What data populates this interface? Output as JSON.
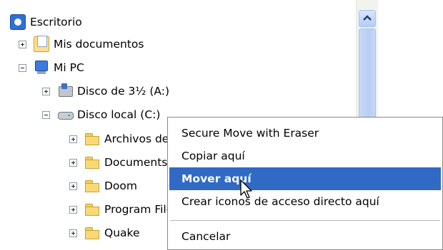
{
  "tree": {
    "items": [
      {
        "label": "Escritorio",
        "icon": "desktop-icon",
        "expander": "none"
      },
      {
        "label": "Mis documentos",
        "icon": "my-documents-icon",
        "expander": "plus"
      },
      {
        "label": "Mi PC",
        "icon": "my-computer-icon",
        "expander": "minus"
      },
      {
        "label": "Disco de 3½ (A:)",
        "icon": "floppy-drive-icon",
        "expander": "plus"
      },
      {
        "label": "Disco local (C:)",
        "icon": "hard-disk-icon",
        "expander": "minus"
      },
      {
        "label": "Archivos de programa",
        "icon": "folder-icon",
        "expander": "plus"
      },
      {
        "label": "Documents and Settings",
        "icon": "folder-icon",
        "expander": "plus"
      },
      {
        "label": "Doom",
        "icon": "folder-icon",
        "expander": "plus"
      },
      {
        "label": "Program Files",
        "icon": "folder-icon",
        "expander": "plus"
      },
      {
        "label": "Quake",
        "icon": "folder-icon",
        "expander": "plus"
      }
    ]
  },
  "scrollbar": {
    "up_icon": "chevron-up-icon"
  },
  "context_menu": {
    "items": [
      {
        "label": "Secure Move with Eraser"
      },
      {
        "label": "Copiar aquí"
      },
      {
        "label": "Mover aquí",
        "highlighted": true
      },
      {
        "label": "Crear iconos de acceso directo aquí"
      },
      {
        "label": "Cancelar"
      }
    ]
  },
  "colors": {
    "menu_highlight": "#316ac5",
    "scrollbar_blue": "#b7cdf3",
    "window_background": "#ffffff"
  }
}
